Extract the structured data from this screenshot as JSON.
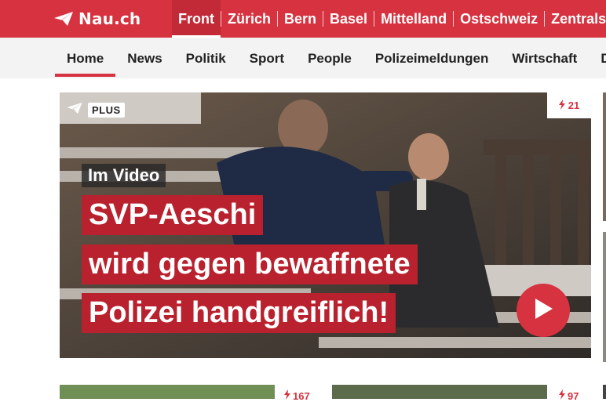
{
  "header": {
    "logo_text": "Nau.ch",
    "regions": [
      "Front",
      "Zürich",
      "Bern",
      "Basel",
      "Mittelland",
      "Ostschweiz",
      "Zentralschweiz"
    ],
    "active_region": "Front"
  },
  "nav": {
    "items": [
      "Home",
      "News",
      "Politik",
      "Sport",
      "People",
      "Polizeimeldungen",
      "Wirtschaft",
      "Digital"
    ],
    "active_item": "Home"
  },
  "hero": {
    "badge": "PLUS",
    "comment_count": "21",
    "caption_small": "Im Video",
    "caption_lines": [
      "SVP-Aeschi",
      "wird gegen bewaffnete",
      "Polizei handgreiflich!"
    ],
    "play_icon": "play-icon"
  },
  "teasers": [
    {
      "comment_count": "167"
    },
    {
      "comment_count": "97"
    }
  ],
  "colors": {
    "brand_red": "#d6323f",
    "caption_red": "#b8212d"
  }
}
